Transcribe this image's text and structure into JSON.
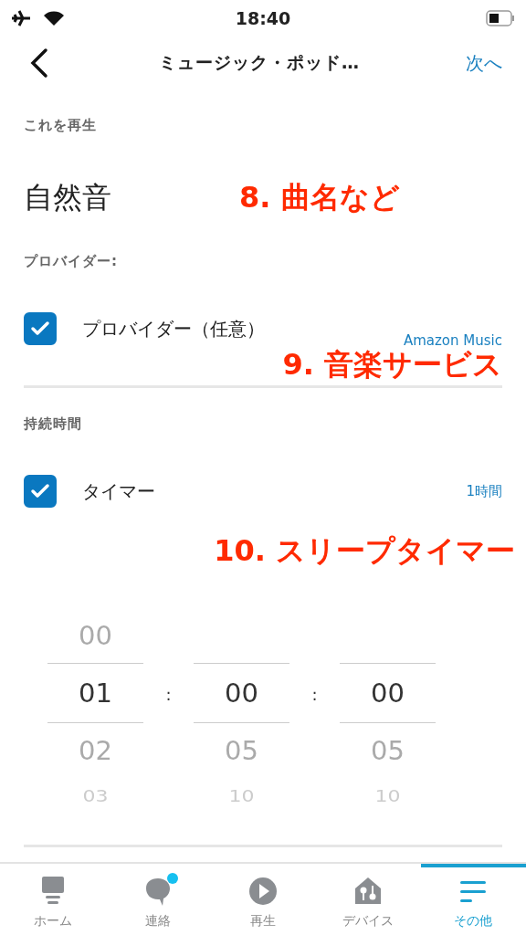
{
  "status_bar": {
    "time": "18:40"
  },
  "nav": {
    "title": "ミュージック・ポッド…",
    "action": "次へ"
  },
  "play_section": {
    "heading": "これを再生",
    "value": "自然音"
  },
  "provider_section": {
    "heading": "プロバイダー:",
    "row": {
      "label": "プロバイダー（任意）",
      "checked": true,
      "value": "Amazon Music"
    }
  },
  "duration_section": {
    "heading": "持続時間",
    "row": {
      "label": "タイマー",
      "checked": true,
      "value": "1時間"
    }
  },
  "annotations": [
    "8. 曲名など",
    "9. 音楽サービス",
    "10. スリープタイマー"
  ],
  "picker": {
    "separators": [
      ":",
      ":"
    ],
    "columns": [
      {
        "items": [
          {
            "label": "00",
            "selected": false
          },
          {
            "label": "01",
            "selected": true
          },
          {
            "label": "02",
            "selected": false
          },
          {
            "label": "03",
            "selected": false
          }
        ]
      },
      {
        "items": [
          {
            "label": "00",
            "selected": true
          },
          {
            "label": "05",
            "selected": false
          },
          {
            "label": "10",
            "selected": false
          }
        ]
      },
      {
        "items": [
          {
            "label": "00",
            "selected": true
          },
          {
            "label": "05",
            "selected": false
          },
          {
            "label": "10",
            "selected": false
          }
        ]
      }
    ]
  },
  "tab_bar": [
    {
      "label": "ホーム",
      "selected": false,
      "badge": false
    },
    {
      "label": "連絡",
      "selected": false,
      "badge": true
    },
    {
      "label": "再生",
      "selected": false,
      "badge": false
    },
    {
      "label": "デバイス",
      "selected": false,
      "badge": false
    },
    {
      "label": "その他",
      "selected": true,
      "badge": false
    }
  ]
}
